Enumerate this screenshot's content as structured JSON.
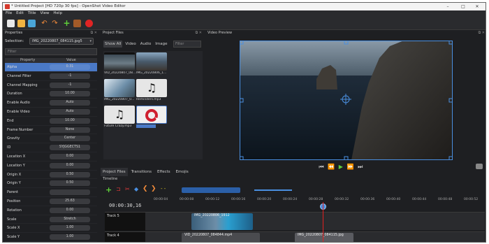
{
  "window": {
    "title": "* Untitled Project [HD 720p 30 fps] - OpenShot Video Editor",
    "controls": [
      "–",
      "□",
      "✕"
    ]
  },
  "menu": [
    "File",
    "Edit",
    "Title",
    "View",
    "Help"
  ],
  "toolbar": {
    "buttons": [
      "new-project",
      "open-project",
      "save-project",
      "undo",
      "redo",
      "import-files",
      "choose-profile",
      "export-video"
    ]
  },
  "properties": {
    "header": "Properties",
    "selection_label": "Selection:",
    "selection_value": "IMG_20220807_084115.jpg5",
    "filter_placeholder": "Filter",
    "columns": [
      "Property",
      "Value"
    ],
    "rows": [
      {
        "name": "Alpha",
        "value": "0.31",
        "selected": true
      },
      {
        "name": "Channel Filter",
        "value": "-1"
      },
      {
        "name": "Channel Mapping",
        "value": "-1"
      },
      {
        "name": "Duration",
        "value": "10.00"
      },
      {
        "name": "Enable Audio",
        "value": "Auto"
      },
      {
        "name": "Enable Video",
        "value": "Auto"
      },
      {
        "name": "End",
        "value": "10.00"
      },
      {
        "name": "Frame Number",
        "value": "None"
      },
      {
        "name": "Gravity",
        "value": "Center"
      },
      {
        "name": "ID",
        "value": "SYJGGECTS1"
      },
      {
        "name": "Location X",
        "value": "0.00"
      },
      {
        "name": "Location Y",
        "value": "0.00"
      },
      {
        "name": "Origin X",
        "value": "0.50"
      },
      {
        "name": "Origin Y",
        "value": "0.50"
      },
      {
        "name": "Parent",
        "value": ""
      },
      {
        "name": "Position",
        "value": "25.63"
      },
      {
        "name": "Rotation",
        "value": "0.00"
      },
      {
        "name": "Scale",
        "value": "Stretch"
      },
      {
        "name": "Scale X",
        "value": "1.00"
      },
      {
        "name": "Scale Y",
        "value": "1.00"
      }
    ]
  },
  "project_files": {
    "header": "Project Files",
    "tabs": [
      "Show All",
      "Video",
      "Audio",
      "Image"
    ],
    "active_tab": "Show All",
    "filter_placeholder": "Filter",
    "items": [
      {
        "name": "VID_20220807_08...",
        "kind": "video"
      },
      {
        "name": "IMG_20220806_1...",
        "kind": "image"
      },
      {
        "name": "IMG_20220807_0...",
        "kind": "image"
      },
      {
        "name": "Reminders.mp3",
        "kind": "audio"
      },
      {
        "name": "Future Crazy.mp3",
        "kind": "audio"
      },
      {
        "name": "",
        "kind": "selected"
      }
    ],
    "bottom_tabs": [
      "Project Files",
      "Transitions",
      "Effects",
      "Emojis"
    ]
  },
  "video_preview": {
    "header": "Video Preview",
    "controls": [
      "⏮",
      "⏪",
      "▶",
      "⏩",
      "⏭"
    ]
  },
  "timeline": {
    "header": "Timeline",
    "timecode": "00:00:30,16",
    "ruler": [
      "00:00:04",
      "00:00:08",
      "00:00:12",
      "00:00:16",
      "00:00:20",
      "00:00:24",
      "00:00:28",
      "00:00:32",
      "00:00:36",
      "00:00:40",
      "00:00:44",
      "00:00:48",
      "00:00:52"
    ],
    "tracks": [
      {
        "name": "Track 5",
        "clips": [
          {
            "label": "IMG_20220806_1912"
          }
        ]
      },
      {
        "name": "Track 4",
        "clips": [
          {
            "label": "VID_20220807_084844.mp4"
          },
          {
            "label": "IMG_20220807_084115.jpg"
          }
        ]
      }
    ]
  }
}
